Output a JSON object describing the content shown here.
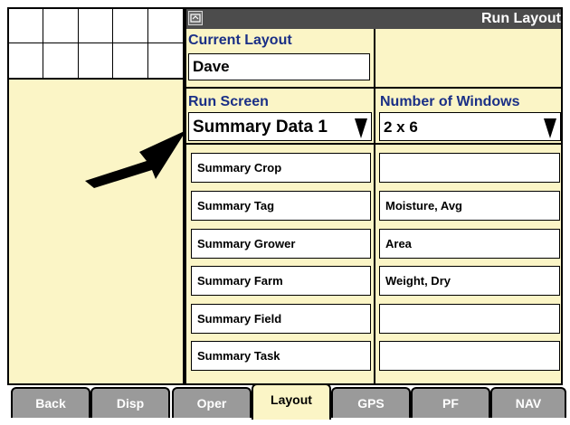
{
  "title": "Run Layout",
  "current_layout": {
    "label": "Current Layout",
    "value": "Dave"
  },
  "run_screen": {
    "label": "Run Screen",
    "value": "Summary Data 1"
  },
  "number_of_windows": {
    "label": "Number of Windows",
    "value": "2 x 6"
  },
  "left_column": [
    "Summary Crop",
    "Summary Tag",
    "Summary Grower",
    "Summary Farm",
    "Summary Field",
    "Summary Task"
  ],
  "right_column": [
    "",
    "Moisture, Avg",
    "Area",
    "Weight, Dry",
    "",
    ""
  ],
  "tabs": [
    {
      "label": "Back"
    },
    {
      "label": "Disp"
    },
    {
      "label": "Oper"
    },
    {
      "label": "Layout"
    },
    {
      "label": "GPS"
    },
    {
      "label": "PF"
    },
    {
      "label": "NAV"
    }
  ],
  "colors": {
    "panel": "#fbf5c6",
    "title_bar": "#4c4c4c",
    "label": "#1a2f86",
    "tab": "#9a9a9a"
  },
  "icons": {
    "title": "layout-screen-icon",
    "pointer": "arrow-pointer"
  }
}
